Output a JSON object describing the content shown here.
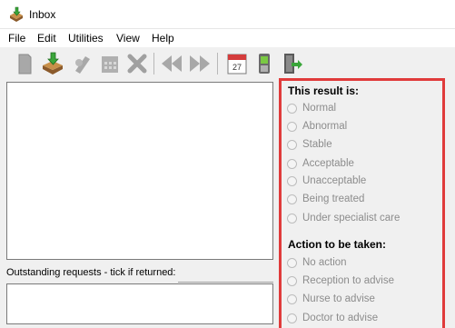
{
  "window": {
    "title": "Inbox"
  },
  "menu": [
    "File",
    "Edit",
    "Utilities",
    "View",
    "Help"
  ],
  "toolbar": {
    "calendar_day": "27"
  },
  "outstanding": {
    "label": "Outstanding requests - tick if returned:"
  },
  "result": {
    "heading": "This result is:",
    "options": [
      "Normal",
      "Abnormal",
      "Stable",
      "Acceptable",
      "Unacceptable",
      "Being treated",
      "Under specialist care"
    ]
  },
  "action": {
    "heading": "Action to be taken:",
    "options": [
      "No action",
      "Reception to advise",
      "Nurse to advise",
      "Doctor to advise"
    ]
  },
  "colors": {
    "highlight_border": "#e03b3b",
    "disabled_text": "#8c8c8c"
  }
}
